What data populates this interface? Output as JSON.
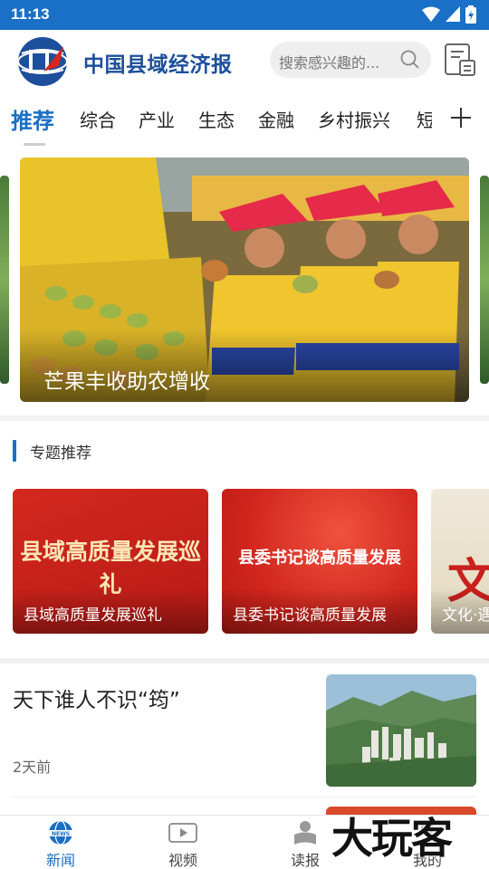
{
  "status_bar": {
    "time": "11:13"
  },
  "header": {
    "logo_name": "中国县域经济报",
    "search_placeholder": "搜索感兴趣的...",
    "icons": [
      "search-icon",
      "newspaper-icon"
    ]
  },
  "tabs": {
    "items": [
      "推荐",
      "综合",
      "产业",
      "生态",
      "金融",
      "乡村振兴",
      "短"
    ],
    "active": "推荐"
  },
  "banner": {
    "caption": "芒果丰收助农增收"
  },
  "topics_section": {
    "title": "专题推荐",
    "cards": [
      {
        "art_text": "县域高质量发展巡礼",
        "caption": "县域高质量发展巡礼"
      },
      {
        "art_text": "县委书记谈高质量发展",
        "caption": "县委书记谈高质量发展"
      },
      {
        "art_text": "文",
        "caption": "文化·遇"
      }
    ]
  },
  "news": [
    {
      "title": "天下谁人不识“筠”",
      "time": "2天前"
    }
  ],
  "bottom_nav": {
    "items": [
      {
        "label": "新闻",
        "icon": "news-globe-icon",
        "active": true
      },
      {
        "label": "视频",
        "icon": "video-icon",
        "active": false
      },
      {
        "label": "读报",
        "icon": "reader-icon",
        "active": false
      },
      {
        "label": "我的",
        "icon": "profile-icon",
        "active": false
      }
    ]
  },
  "watermark": "大玩客",
  "colors": {
    "brand_blue": "#1a6fc6",
    "logo_blue": "#1d4f9c",
    "card_red": "#c8201c"
  }
}
